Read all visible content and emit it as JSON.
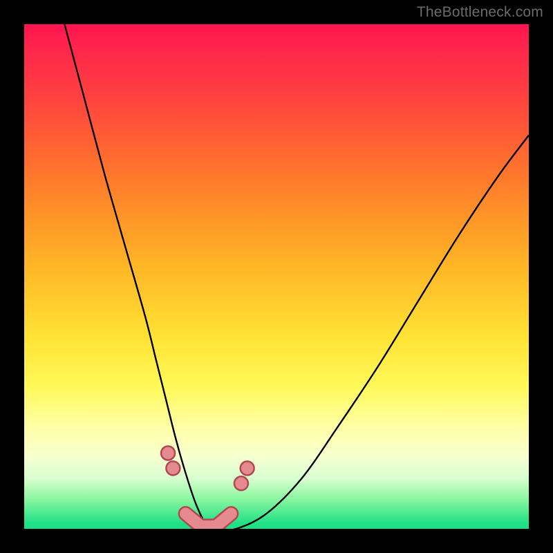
{
  "watermark": "TheBottleneck.com",
  "colors": {
    "background": "#000000",
    "gradient_top": "#ff1450",
    "gradient_mid1": "#ff9428",
    "gradient_mid2": "#ffe334",
    "gradient_bottom": "#1ee085",
    "curve": "#000000",
    "marker_fill": "#e58b8f",
    "marker_stroke": "#b04852"
  },
  "chart_data": {
    "type": "line",
    "title": "",
    "xlabel": "",
    "ylabel": "",
    "xlim": [
      0,
      100
    ],
    "ylim": [
      0,
      100
    ],
    "series": [
      {
        "name": "bottleneck-curve",
        "x": [
          8,
          12,
          16,
          20,
          24,
          26,
          28,
          30,
          32,
          34,
          36,
          38,
          42,
          48,
          55,
          62,
          70,
          78,
          86,
          94,
          100
        ],
        "y": [
          100,
          85,
          70,
          56,
          42,
          34,
          26,
          18,
          11,
          5,
          1,
          0,
          0,
          3,
          10,
          20,
          32,
          45,
          58,
          70,
          78
        ]
      }
    ],
    "markers": {
      "name": "highlight-points",
      "x": [
        28.5,
        29.5,
        32,
        35,
        38,
        41,
        43,
        44.2
      ],
      "y": [
        15,
        12,
        3,
        0.5,
        0.5,
        3,
        9,
        12
      ]
    }
  }
}
